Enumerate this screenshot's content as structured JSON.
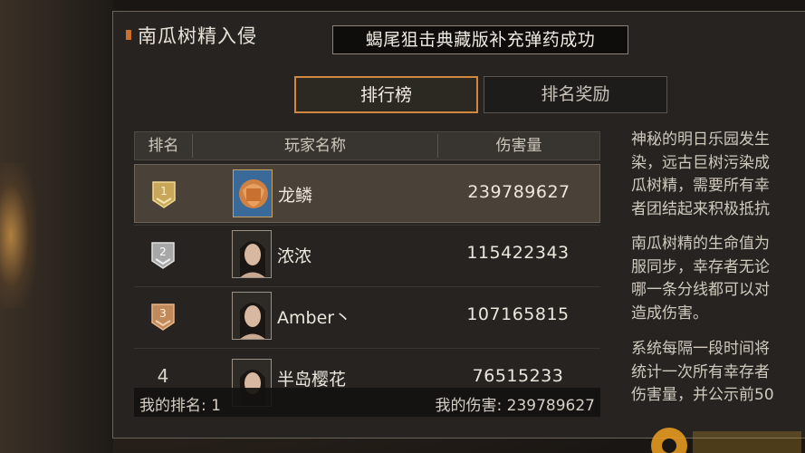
{
  "window": {
    "title": "南瓜树精入侵"
  },
  "notice": "蝎尾狙击典藏版补充弹药成功",
  "tabs": [
    {
      "label": "排行榜",
      "active": true
    },
    {
      "label": "排名奖励",
      "active": false
    }
  ],
  "table": {
    "columns": [
      "排名",
      "玩家名称",
      "伤害量"
    ],
    "rows": [
      {
        "rank": "1",
        "badge": "gold",
        "name": "龙鳞",
        "damage": "239789627",
        "selected": true
      },
      {
        "rank": "2",
        "badge": "silver",
        "name": "浓浓",
        "damage": "115422343",
        "selected": false
      },
      {
        "rank": "3",
        "badge": "bronze",
        "name": "Amber丶",
        "damage": "107165815",
        "selected": false
      },
      {
        "rank": "4",
        "badge": "none",
        "name": "半岛樱花",
        "damage": "76515233",
        "selected": false
      }
    ]
  },
  "footer": {
    "my_rank": "我的排名: 1",
    "my_damage": "我的伤害: 239789627"
  },
  "description": {
    "para1": [
      "神秘的明日乐园发生",
      "染，远古巨树污染成",
      "瓜树精，需要所有幸",
      "者团结起来积极抵抗"
    ],
    "para2": [
      "南瓜树精的生命值为",
      "服同步，幸存者无论",
      "哪一条分线都可以对",
      "造成伤害。"
    ],
    "para3": [
      "系统每隔一段时间将",
      "统计一次所有幸存者",
      "伤害量，并公示前50"
    ]
  },
  "colors": {
    "accent": "#d2873e",
    "panel": "#262320",
    "gold": "#c9a75a",
    "silver": "#b8b8b8",
    "bronze": "#c08a5a"
  }
}
